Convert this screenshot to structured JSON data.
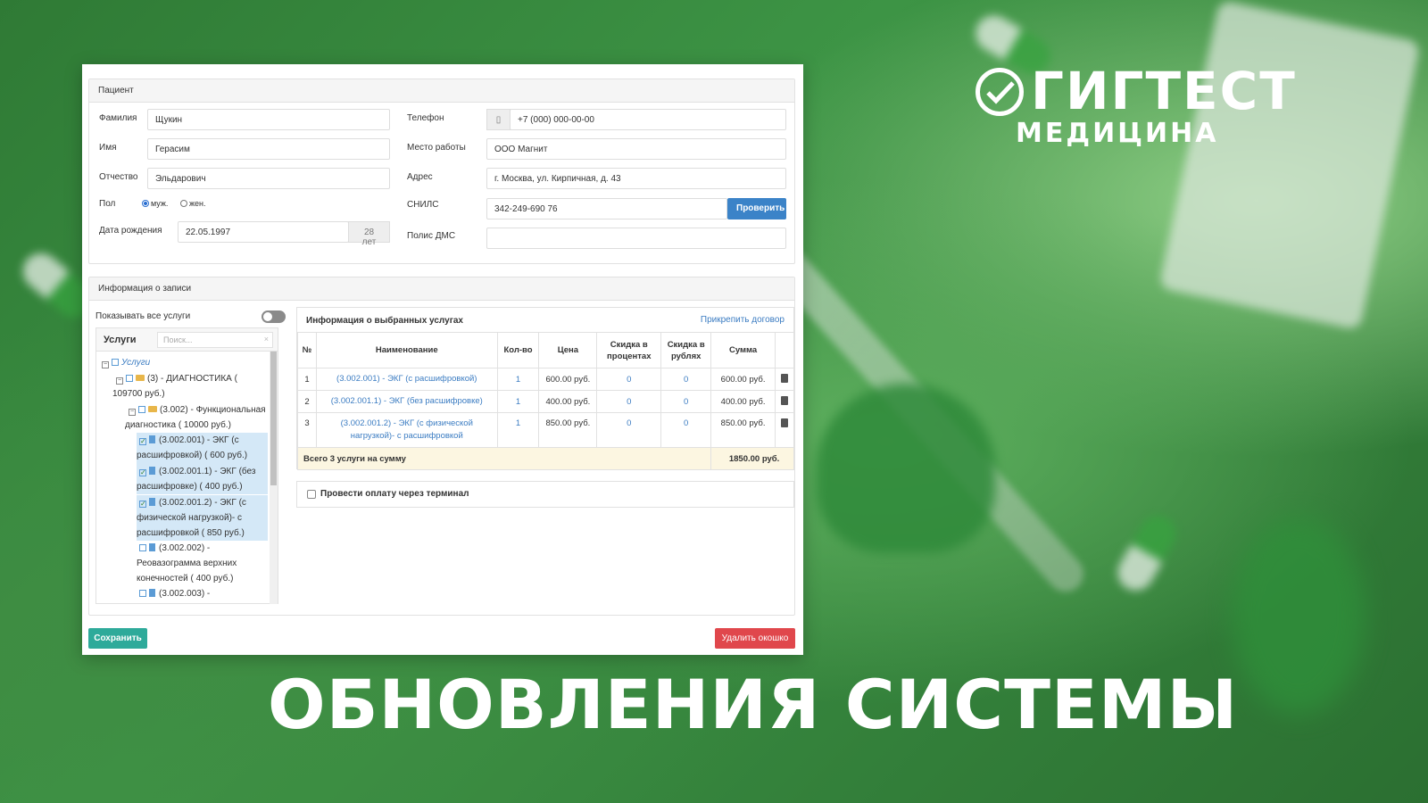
{
  "brand": {
    "name": "ГИГТЕСТ",
    "subtitle": "МЕДИЦИНА"
  },
  "headline": "ОБНОВЛЕНИЯ СИСТЕМЫ",
  "patient": {
    "section_title": "Пациент",
    "labels": {
      "surname": "Фамилия",
      "name": "Имя",
      "patronymic": "Отчество",
      "sex": "Пол",
      "birthdate": "Дата рождения",
      "phone": "Телефон",
      "workplace": "Место работы",
      "address": "Адрес",
      "snils": "СНИЛС",
      "dms": "Полис ДМС"
    },
    "values": {
      "surname": "Щукин",
      "name": "Герасим",
      "patronymic": "Эльдарович",
      "birthdate": "22.05.1997",
      "age": "28 лет",
      "phone": "+7 (000) 000-00-00",
      "workplace": "ООО Магнит",
      "address": "г. Москва, ул. Кирпичная, д. 43",
      "snils": "342-249-690 76",
      "dms": ""
    },
    "sex_options": [
      "муж.",
      "жен."
    ],
    "sex_selected": "муж.",
    "check_button": "Проверить"
  },
  "record": {
    "section_title": "Информация о записи",
    "show_all_label": "Показывать все услуги",
    "show_all_enabled": false,
    "tree": {
      "title": "Услуги",
      "search_placeholder": "Поиск...",
      "clear_icon": "×",
      "nodes": [
        {
          "text": "Услуги"
        },
        {
          "text": "(3) - ДИАГНОСТИКА (",
          "text2": "109700 руб.)"
        },
        {
          "text": "(3.002) - Функциональная",
          "text2": "диагностика ( 10000 руб.)"
        },
        {
          "text": "(3.002.001) - ЭКГ (с",
          "text2": "расшифровкой) ( 600 руб.)",
          "checked": true
        },
        {
          "text": "(3.002.001.1) - ЭКГ (без",
          "text2": "расшифровке) ( 400 руб.)",
          "checked": true
        },
        {
          "text": "(3.002.001.2) - ЭКГ (с",
          "text2": "физической нагрузкой)- с",
          "text3": "расшифровкой ( 850 руб.)",
          "checked": true
        },
        {
          "text": "(3.002.002) -",
          "text2": "Реовазограмма верхних",
          "text3": "конечностей ( 400 руб.)"
        },
        {
          "text": "(3.002.003) -"
        }
      ]
    },
    "services": {
      "title": "Информация о выбранных услугах",
      "attach_link": "Прикрепить договор",
      "columns": [
        "№",
        "Наименование",
        "Кол-во",
        "Цена",
        "Скидка в процентах",
        "Скидка в рублях",
        "Сумма"
      ],
      "rows": [
        {
          "n": "1",
          "name": "(3.002.001) - ЭКГ (с расшифровкой)",
          "qty": "1",
          "price": "600.00 руб.",
          "disc_pct": "0",
          "disc_rub": "0",
          "sum": "600.00 руб."
        },
        {
          "n": "2",
          "name": "(3.002.001.1) - ЭКГ (без расшифровке)",
          "qty": "1",
          "price": "400.00 руб.",
          "disc_pct": "0",
          "disc_rub": "0",
          "sum": "400.00 руб."
        },
        {
          "n": "3",
          "name": "(3.002.001.2) - ЭКГ (с физической нагрузкой)- с расшифровкой",
          "qty": "1",
          "price": "850.00 руб.",
          "disc_pct": "0",
          "disc_rub": "0",
          "sum": "850.00 руб."
        }
      ],
      "total_label": "Всего 3 услуги на сумму",
      "total_value": "1850.00 руб."
    },
    "terminal_label": "Провести оплату через терминал",
    "terminal_checked": false
  },
  "footer": {
    "save": "Сохранить",
    "delete": "Удалить окошко"
  },
  "colors": {
    "accent_blue": "#3b83c8",
    "save_green": "#2eaa9a",
    "delete_red": "#e0474c",
    "background_green": "#3d9445"
  }
}
